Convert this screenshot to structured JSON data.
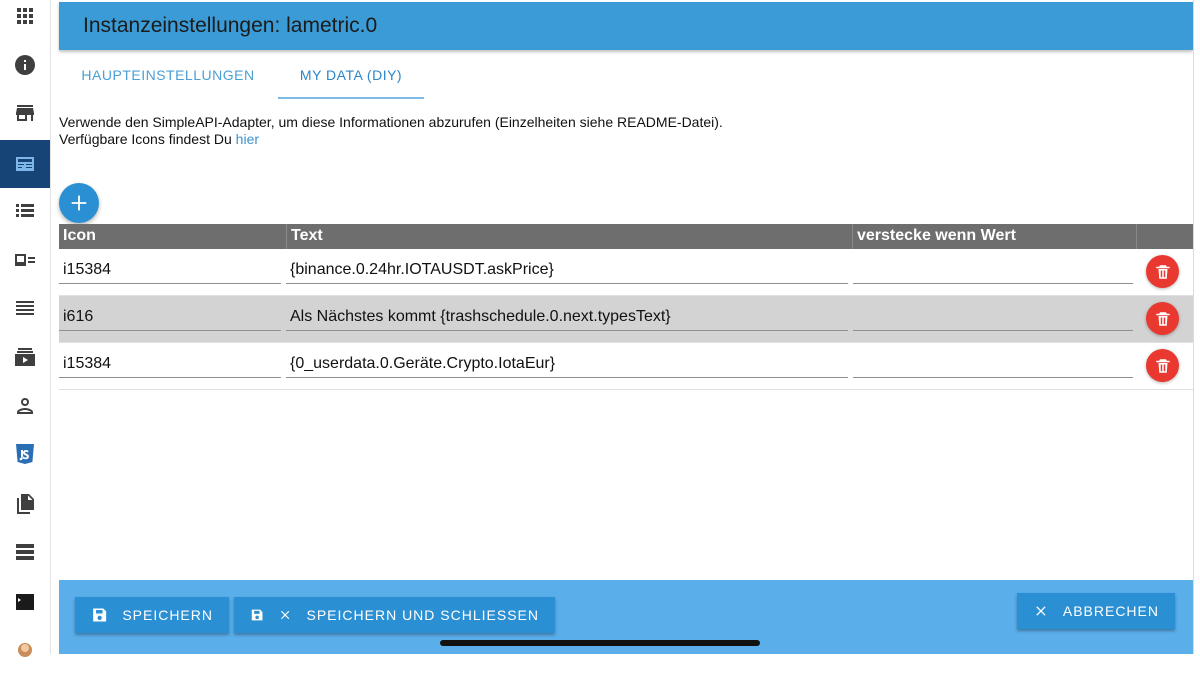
{
  "window": {
    "title": "Instanzeinstellungen: lametric.0"
  },
  "sidebar": {
    "items": [
      {
        "icon": "apps-icon"
      },
      {
        "icon": "info-icon"
      },
      {
        "icon": "store-icon"
      },
      {
        "icon": "instances-icon",
        "active": true
      },
      {
        "icon": "list-icon"
      },
      {
        "icon": "id-card-icon"
      },
      {
        "icon": "text-lines-icon"
      },
      {
        "icon": "media-icon"
      },
      {
        "icon": "user-icon"
      },
      {
        "icon": "javascript-icon"
      },
      {
        "icon": "files-icon"
      },
      {
        "icon": "hosts-icon"
      },
      {
        "icon": "terminal-icon"
      },
      {
        "icon": "avatar-icon"
      }
    ]
  },
  "tabs": [
    {
      "label": "HAUPTEINSTELLUNGEN",
      "active": false
    },
    {
      "label": "MY DATA (DIY)",
      "active": true
    }
  ],
  "description": {
    "line1": "Verwende den SimpleAPI-Adapter, um diese Informationen abzurufen (Einzelheiten siehe README-Datei).",
    "line2_prefix": "Verfügbare Icons findest Du ",
    "line2_link": "hier"
  },
  "table": {
    "headers": [
      "Icon",
      "Text",
      "verstecke wenn Wert",
      ""
    ],
    "rows": [
      {
        "icon": "i15384",
        "text": "{binance.0.24hr.IOTAUSDT.askPrice}",
        "hide": ""
      },
      {
        "icon": "i616",
        "text": "Als Nächstes kommt {trashschedule.0.next.typesText}",
        "hide": ""
      },
      {
        "icon": "i15384",
        "text": "{0_userdata.0.Geräte.Crypto.IotaEur}",
        "hide": ""
      }
    ]
  },
  "footer": {
    "save_label": "SPEICHERN",
    "save_close_label": "SPEICHERN UND SCHLIESSEN",
    "cancel_label": "ABBRECHEN"
  },
  "colors": {
    "title_bar": "#3a9bd6",
    "accent": "#2b8fd4",
    "bottom_bar": "#5aaeea",
    "delete": "#e8382f",
    "sidebar_active": "#164477"
  }
}
